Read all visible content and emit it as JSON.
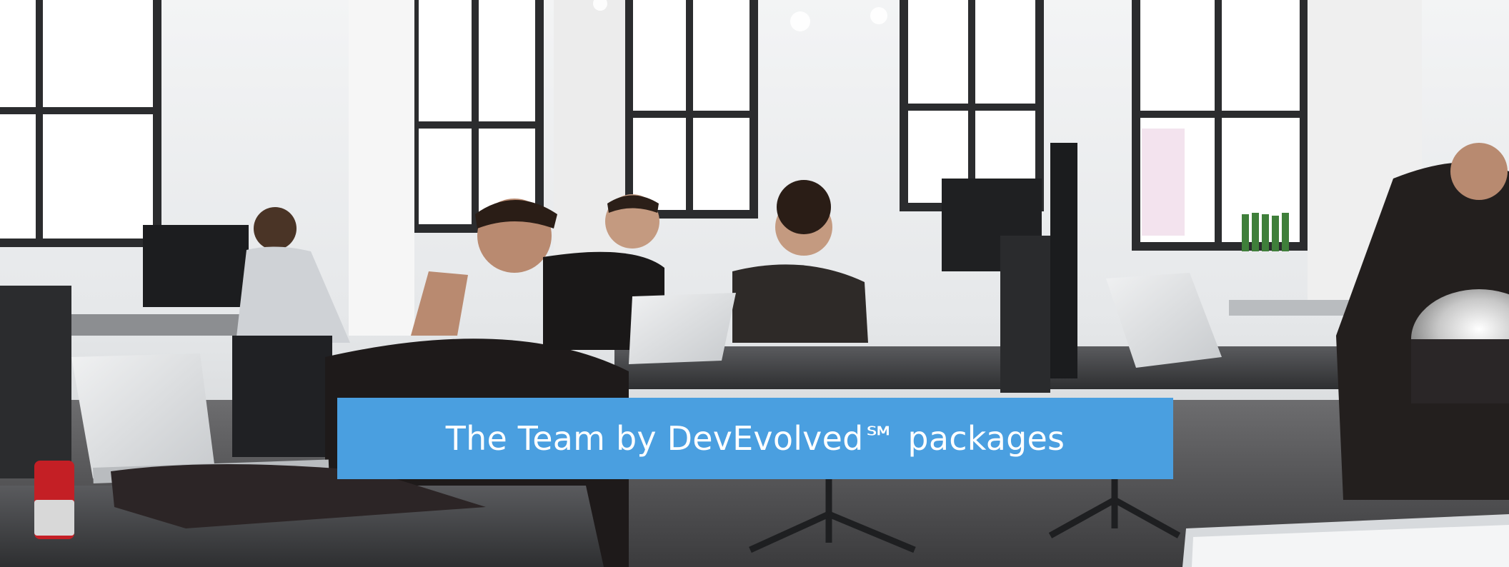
{
  "banner": {
    "title": "The Team by DevEvolved℠ packages",
    "background_color": "#4a9fe0",
    "text_color": "#ffffff"
  },
  "photo": {
    "subject": "office-team-photo"
  }
}
